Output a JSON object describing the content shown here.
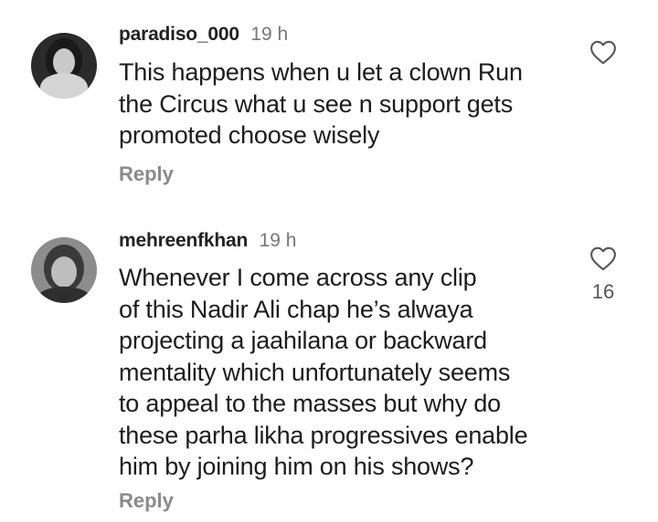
{
  "comments": [
    {
      "username": "paradiso_000",
      "time": "19 h",
      "text_lines": [
        "This happens when u let a clown Run",
        "the Circus what u see n support gets",
        "promoted choose wisely"
      ],
      "reply_label": "Reply",
      "like_icon": "heart-outline-icon",
      "like_count": ""
    },
    {
      "username": "mehreenfkhan",
      "time": "19 h",
      "text_lines": [
        "Whenever I come across any clip",
        "of this Nadir Ali chap he’s alwaya",
        "projecting a jaahilana or backward",
        "mentality which unfortunately seems",
        "to appeal to the masses but why do",
        "these parha likha progressives enable",
        "him by joining him on his shows?"
      ],
      "reply_label": "Reply",
      "like_icon": "heart-outline-icon",
      "like_count": "16"
    }
  ],
  "colors": {
    "username": "#222222",
    "time": "#777777",
    "reply": "#8a8a8a",
    "text": "#1c1c1c",
    "heart_stroke": "#555555"
  }
}
